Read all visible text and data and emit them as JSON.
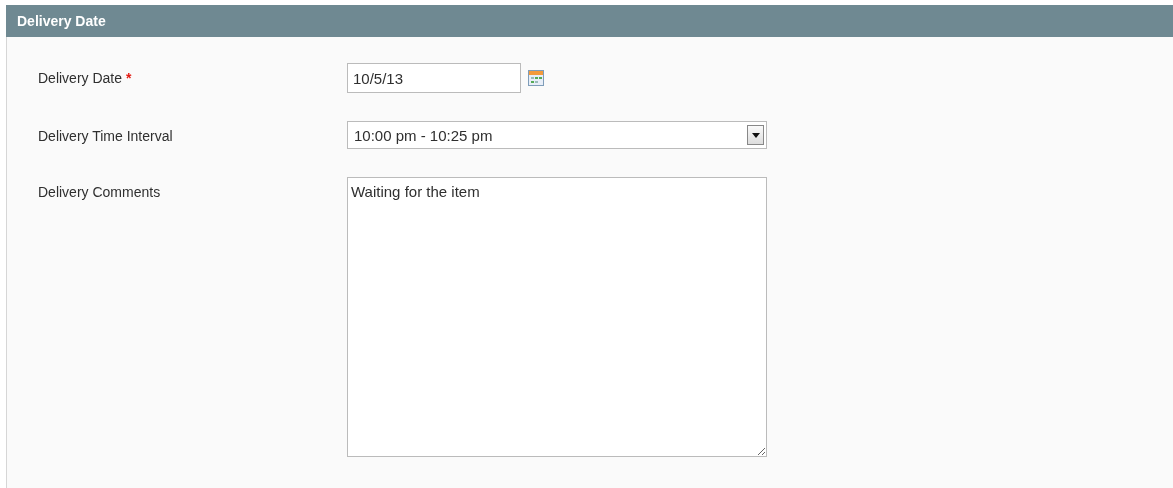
{
  "panel": {
    "title": "Delivery Date"
  },
  "fields": [
    {
      "kind": "date",
      "label": "Delivery Date",
      "required_mark": "*",
      "value": "10/5/13"
    },
    {
      "kind": "select",
      "label": "Delivery Time Interval",
      "value": "10:00 pm - 10:25 pm"
    },
    {
      "kind": "textarea",
      "label": "Delivery Comments",
      "value": "Waiting for the item"
    }
  ]
}
